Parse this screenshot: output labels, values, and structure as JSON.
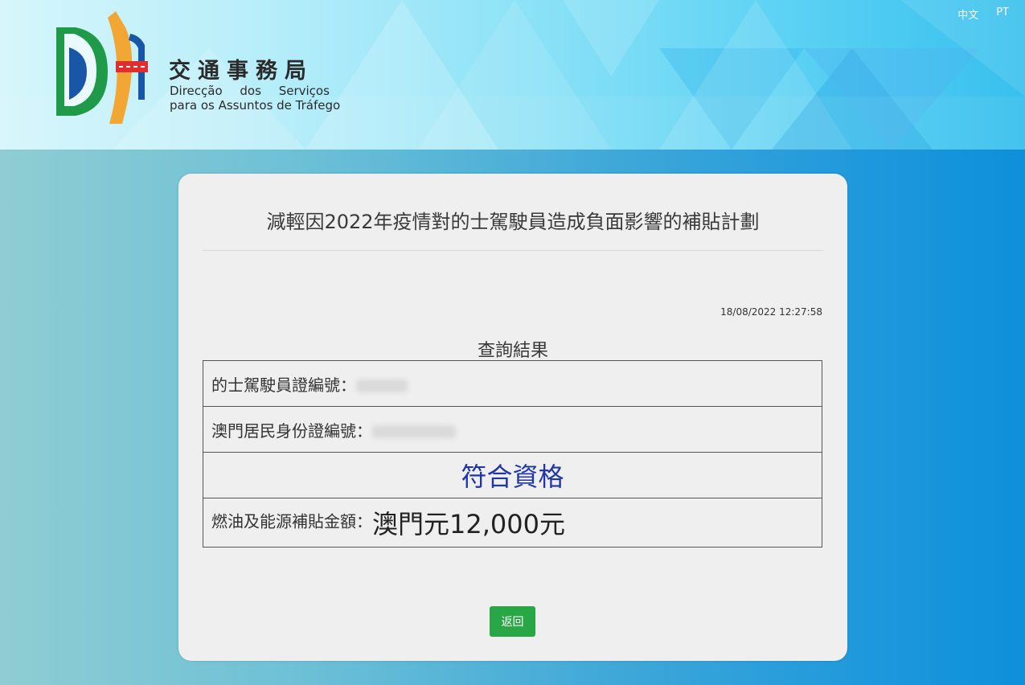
{
  "header": {
    "lang_zh": "中文",
    "lang_pt": "PT",
    "logo": {
      "name_cn": "交通事務局",
      "name_pt_line1": "Direcção dos Serviços",
      "name_pt_line2": "para os Assuntos de Tráfego"
    }
  },
  "page": {
    "title": "減輕因2022年疫情對的士駕駛員造成負面影響的補貼計劃",
    "timestamp": "18/08/2022 12:27:58",
    "result_heading": "查詢結果"
  },
  "result": {
    "driver_cert_label": "的士駕駛員證編號：",
    "id_card_label": "澳門居民身份證編號：",
    "status": "符合資格",
    "subsidy_label": "燃油及能源補貼金額：",
    "subsidy_amount": "澳門元12,000元"
  },
  "actions": {
    "back_label": "返回"
  },
  "colors": {
    "status_text": "#1f35a8",
    "back_button": "#2aa745"
  }
}
